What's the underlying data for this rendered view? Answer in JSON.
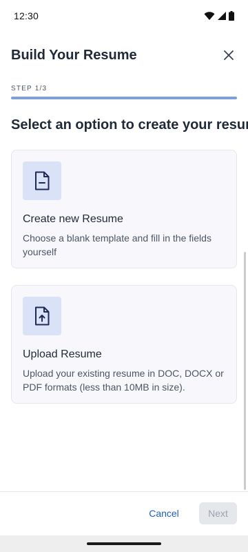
{
  "status_bar": {
    "time": "12:30",
    "icons": [
      "wifi-icon",
      "signal-icon",
      "battery-icon"
    ]
  },
  "header": {
    "title": "Build Your Resume",
    "close_icon": "close-icon"
  },
  "progress": {
    "step_label": "STEP 1/3",
    "fraction": 1.0
  },
  "main": {
    "heading": "Select an option to create your resume",
    "options": [
      {
        "icon": "document-minus-icon",
        "title": "Create new Resume",
        "description": "Choose a blank template and fill in the fields yourself"
      },
      {
        "icon": "document-upload-icon",
        "title": "Upload Resume",
        "description": "Upload your existing resume in DOC, DOCX or PDF formats (less than 10MB in size)."
      }
    ]
  },
  "footer": {
    "cancel_label": "Cancel",
    "next_label": "Next"
  },
  "colors": {
    "accent": "#1d5fbf",
    "progress": "#7fa0d6",
    "icon_bg": "#d9e2f7",
    "card_bg": "#f8f8fc"
  }
}
